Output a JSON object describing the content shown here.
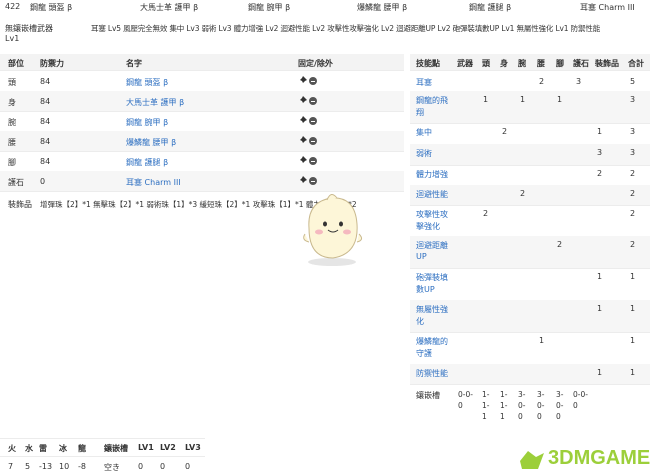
{
  "top": {
    "defense": "422",
    "equips": [
      "鋼龍 頭盔 β",
      "大馬士革 護甲 β",
      "鋼龍 腕甲 β",
      "爆鱗龍 腰甲 β",
      "鋼龍 護腿 β",
      "耳塞 Charm III"
    ],
    "weapon": "無鑲嵌槽武器",
    "skills_line": "耳塞 Lv5 風壓完全無效 集中 Lv3 弱術 Lv3 體力增強 Lv2 迴避性能 Lv2 攻擊性攻擊強化 Lv2 迴避距離UP Lv2 砲彈裝填數UP Lv1 無屬性強化 Lv1 防禦性能",
    "weapon_level": "Lv1"
  },
  "left_table": {
    "headers": [
      "部位",
      "防禦力",
      "名字",
      "固定/除外"
    ],
    "rows": [
      {
        "part": "頭",
        "def": "84",
        "name": "鋼龍 頭盔 β"
      },
      {
        "part": "身",
        "def": "84",
        "name": "大馬士革 護甲 β"
      },
      {
        "part": "腕",
        "def": "84",
        "name": "鋼龍 腕甲 β"
      },
      {
        "part": "腰",
        "def": "84",
        "name": "爆鱗龍 腰甲 β"
      },
      {
        "part": "腳",
        "def": "84",
        "name": "鋼龍 護腿 β"
      },
      {
        "part": "護石",
        "def": "0",
        "name": "耳塞 Charm III"
      }
    ],
    "deco_label": "裝飾品",
    "deco_text": "增彈珠【2】*1 無擊珠【2】*1 弱術珠【1】*3 緩短珠【2】*1 攻擊珠【1】*1 體力珠【1】*2"
  },
  "right_table": {
    "headers": [
      "技能點",
      "武器",
      "頭",
      "身",
      "腕",
      "腰",
      "腳",
      "護石",
      "裝飾品",
      "合計"
    ],
    "rows": [
      {
        "skill": [
          "耳塞"
        ],
        "cells": [
          "",
          "",
          "",
          "",
          "2",
          "",
          "3",
          "",
          "5"
        ]
      },
      {
        "skill": [
          "鋼龍的飛",
          "翔"
        ],
        "cells": [
          "",
          "1",
          "",
          "1",
          "",
          "1",
          "",
          "",
          "3"
        ]
      },
      {
        "skill": [
          "集中"
        ],
        "cells": [
          "",
          "",
          "2",
          "",
          "",
          "",
          "",
          "1",
          "3"
        ]
      },
      {
        "skill": [
          "弱術"
        ],
        "cells": [
          "",
          "",
          "",
          "",
          "",
          "",
          "",
          "3",
          "3"
        ]
      },
      {
        "skill": [
          "體力增強"
        ],
        "cells": [
          "",
          "",
          "",
          "",
          "",
          "",
          "",
          "2",
          "2"
        ]
      },
      {
        "skill": [
          "迴避性能"
        ],
        "cells": [
          "",
          "",
          "",
          "2",
          "",
          "",
          "",
          "",
          "2"
        ]
      },
      {
        "skill": [
          "攻擊性攻",
          "擊強化"
        ],
        "cells": [
          "",
          "2",
          "",
          "",
          "",
          "",
          "",
          "",
          "2"
        ]
      },
      {
        "skill": [
          "迴避距離",
          "UP"
        ],
        "cells": [
          "",
          "",
          "",
          "",
          "",
          "2",
          "",
          "",
          "2"
        ]
      },
      {
        "skill": [
          "砲彈裝填",
          "數UP"
        ],
        "cells": [
          "",
          "",
          "",
          "",
          "",
          "",
          "",
          "1",
          "1"
        ]
      },
      {
        "skill": [
          "無屬性強",
          "化"
        ],
        "cells": [
          "",
          "",
          "",
          "",
          "",
          "",
          "",
          "1",
          "1"
        ]
      },
      {
        "skill": [
          "爆鱗龍的",
          "守護"
        ],
        "cells": [
          "",
          "",
          "",
          "",
          "1",
          "",
          "",
          "",
          "1"
        ]
      },
      {
        "skill": [
          "防禦性能"
        ],
        "cells": [
          "",
          "",
          "",
          "",
          "",
          "",
          "",
          "1",
          "1"
        ]
      }
    ],
    "slots_label": "鑲嵌槽",
    "slots": [
      [
        "0-0-",
        "0"
      ],
      [
        "1-",
        "1-",
        "1"
      ],
      [
        "1-",
        "1-",
        "1"
      ],
      [
        "3-",
        "0-",
        "0"
      ],
      [
        "3-",
        "0-",
        "0"
      ],
      [
        "3-",
        "0-",
        "0"
      ],
      [
        "0-0-",
        "0"
      ]
    ]
  },
  "bottom": {
    "headers": [
      "火",
      "水",
      "雷",
      "冰",
      "龍",
      "鑲嵌槽",
      "LV1",
      "LV2",
      "LV3"
    ],
    "values": [
      "7",
      "5",
      "-13",
      "10",
      "-8",
      "空き",
      "0",
      "0",
      "0"
    ]
  },
  "watermark": {
    "text": "3DMGAME",
    "url": "3dmgame.com"
  },
  "colors": {
    "link": "#2d6fc1",
    "accent_green": "#5ab02e",
    "watermark": "#9ccf3a"
  }
}
